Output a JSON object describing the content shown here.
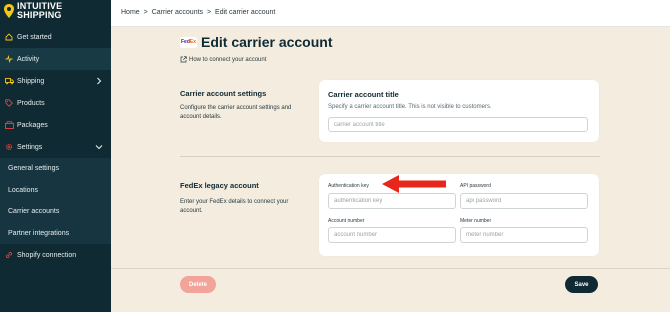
{
  "brand": {
    "line1": "INTUITIVE",
    "line2": "SHIPPING",
    "accent": "#f5c518"
  },
  "sidebar": {
    "items": [
      {
        "label": "Get started",
        "icon": "home-icon"
      },
      {
        "label": "Activity",
        "icon": "activity-icon"
      },
      {
        "label": "Shipping",
        "icon": "truck-icon"
      },
      {
        "label": "Products",
        "icon": "tag-icon"
      },
      {
        "label": "Packages",
        "icon": "package-icon"
      },
      {
        "label": "Settings",
        "icon": "gear-icon"
      }
    ],
    "settings_sub": [
      {
        "label": "General settings"
      },
      {
        "label": "Locations"
      },
      {
        "label": "Carrier accounts"
      },
      {
        "label": "Partner integrations"
      }
    ],
    "shopify": {
      "label": "Shopify connection",
      "icon": "link-icon"
    }
  },
  "breadcrumb": {
    "home": "Home",
    "sep": ">",
    "carrier": "Carrier accounts",
    "current": "Edit carrier account"
  },
  "page": {
    "logo_fe": "Fed",
    "logo_ex": "Ex",
    "title": "Edit carrier account",
    "help_link": "How to connect your account"
  },
  "settings_section": {
    "title": "Carrier account settings",
    "desc": "Configure the carrier account settings and account details.",
    "card_title": "Carrier account title",
    "card_sub": "Specify a carrier account title. This is not visible to customers.",
    "title_placeholder": "carrier account title"
  },
  "legacy_section": {
    "title": "FedEx legacy account",
    "desc": "Enter your FedEx details to connect your account.",
    "auth_label": "Authentication key",
    "auth_placeholder": "authentication key",
    "api_label": "API password",
    "api_placeholder": "api password",
    "account_label": "Account number",
    "account_placeholder": "account number",
    "meter_label": "Meter number",
    "meter_placeholder": "meter number"
  },
  "buttons": {
    "delete": "Delete",
    "save": "Save"
  },
  "colors": {
    "sidebar_bg": "#0f2a32",
    "content_bg": "#f3ecdf",
    "delete_bg": "#f2a39a",
    "save_bg": "#0f2a32",
    "annotation_arrow": "#e8261c"
  }
}
